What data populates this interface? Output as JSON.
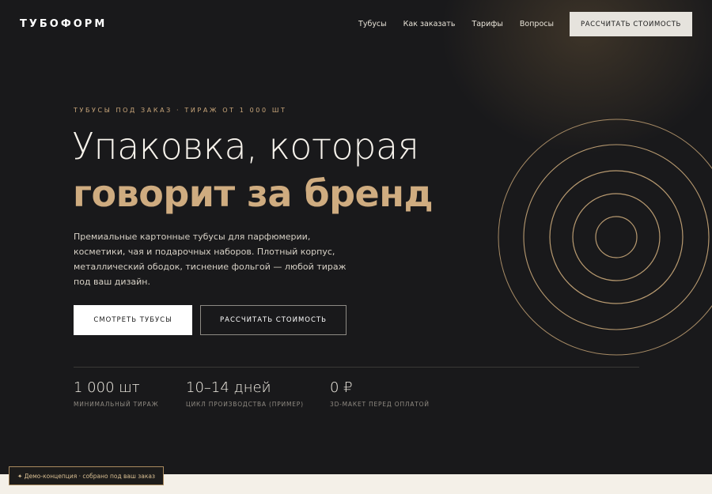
{
  "header": {
    "logo": "ТУБОФОРМ",
    "nav": [
      {
        "label": "Тубусы"
      },
      {
        "label": "Как заказать"
      },
      {
        "label": "Тарифы"
      },
      {
        "label": "Вопросы"
      }
    ],
    "cta_label": "РАССЧИТАТЬ СТОИМОСТЬ"
  },
  "hero": {
    "eyebrow": "ТУБУСЫ ПОД ЗАКАЗ · ТИРАЖ ОТ 1 000 ШТ",
    "headline_line1": "Упаковка, которая",
    "headline_line2": "говорит за бренд",
    "lead": "Премиальные картонные тубусы для парфюмерии, косметики, чая и подарочных наборов. Плотный корпус, металлический ободок, тиснение фольгой — любой тираж под ваш дизайн.",
    "primary_button": "СМОТРЕТЬ ТУБУСЫ",
    "secondary_button": "РАССЧИТАТЬ СТОИМОСТЬ"
  },
  "stats": [
    {
      "value": "1 000 шт",
      "label": "МИНИМАЛЬНЫЙ ТИРАЖ"
    },
    {
      "value": "10–14 дней",
      "label": "ЦИКЛ ПРОИЗВОДСТВА (ПРИМЕР)"
    },
    {
      "value": "0 ₽",
      "label": "3D-МАКЕТ ПЕРЕД ОПЛАТОЙ"
    }
  ],
  "demo_badge": {
    "icon": "sparkle-icon",
    "text": "✦ Демо-концепция · собрано под ваш заказ"
  },
  "colors": {
    "background": "#19191b",
    "accent_gold": "#cfac80",
    "eyebrow_gold": "#c9a67a",
    "light_band": "#f4f0e8"
  }
}
